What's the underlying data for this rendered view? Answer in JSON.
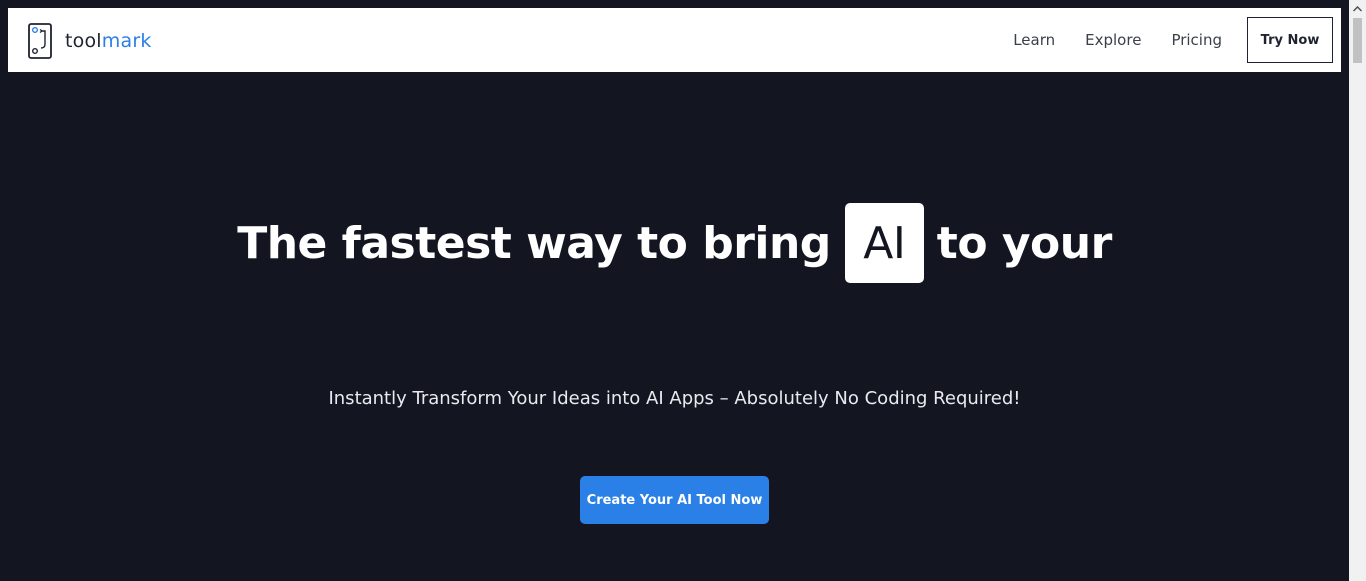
{
  "brand": {
    "name_part1": "tool",
    "name_part2": "mark",
    "logo_icon": "toolmark-logo-icon",
    "accent_color": "#2a80e6"
  },
  "nav": {
    "links": [
      "Learn",
      "Explore",
      "Pricing"
    ],
    "try_label": "Try Now"
  },
  "hero": {
    "headline_before": "The fastest way to bring",
    "headline_highlight": "AI",
    "headline_after": "to your",
    "subheadline": "Instantly Transform Your Ideas into AI Apps – Absolutely No Coding Required!",
    "cta_label": "Create Your AI Tool Now",
    "background_color": "#131621",
    "cta_color": "#2a80e6"
  },
  "scrollbar": {
    "up_icon": "chevron-up-icon"
  }
}
